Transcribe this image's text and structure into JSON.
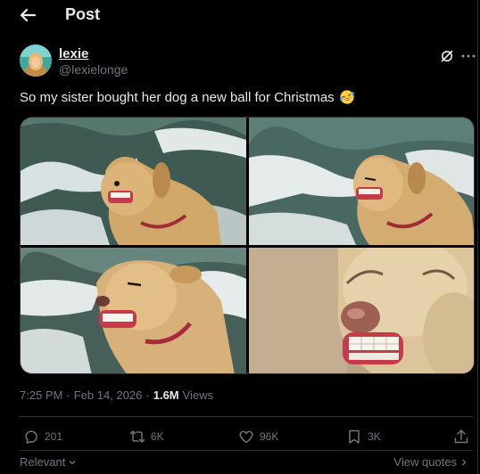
{
  "header": {
    "title": "Post"
  },
  "author": {
    "display_name": "lexie",
    "handle": "@lexielonge"
  },
  "post": {
    "text": "So my sister bought her dog a new ball for Christmas",
    "emoji": "rolling-on-floor-laughing"
  },
  "media": {
    "image_count": 4
  },
  "meta": {
    "time": "7:25 PM",
    "separator": "·",
    "date": "Feb 14, 2026",
    "views_count": "1.6M",
    "views_label": "Views"
  },
  "actions": {
    "replies": "201",
    "reposts": "6K",
    "likes": "96K",
    "bookmarks": "3K"
  },
  "footer": {
    "sort_label": "Relevant",
    "view_quotes": "View quotes"
  },
  "colors": {
    "background": "#000000",
    "text": "#e7e9ea",
    "muted": "#71767b",
    "border": "#2f3336"
  }
}
